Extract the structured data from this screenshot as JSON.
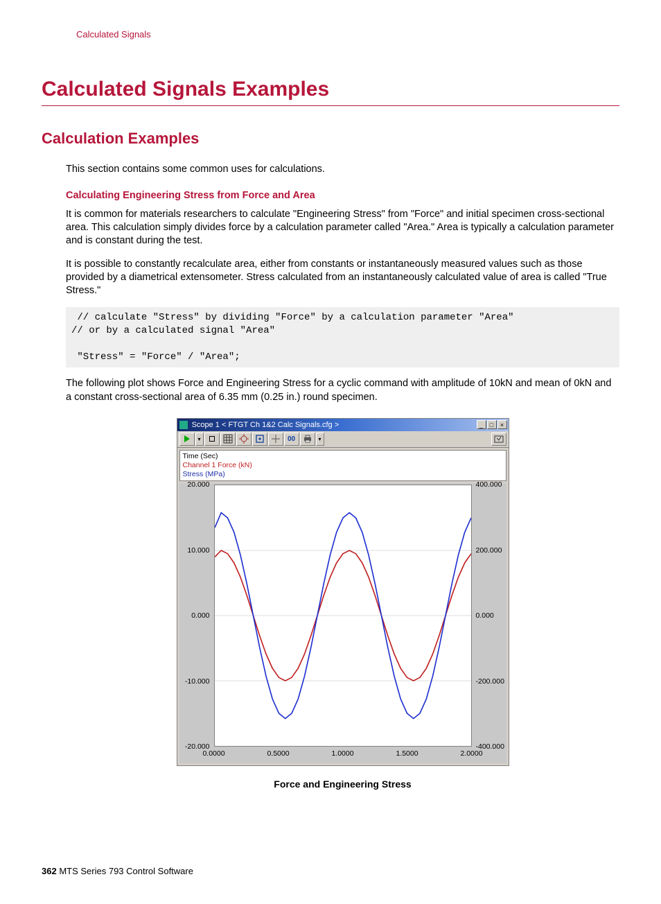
{
  "runhead": "Calculated Signals",
  "h1": "Calculated Signals Examples",
  "h2": "Calculation Examples",
  "intro": "This section contains some common uses for calculations.",
  "h3": "Calculating Engineering Stress from Force and Area",
  "p1": "It is common for materials researchers to calculate \"Engineering Stress\" from \"Force\" and initial specimen cross-sectional area. This calculation simply divides force by a calculation parameter called \"Area.\" Area is typically a calculation parameter and is constant during the test.",
  "p2": "It is possible to constantly recalculate area, either from constants or instantaneously measured values such as those provided by a diametrical extensometer. Stress calculated from an instantaneously calculated value of area is called \"True Stress.\"",
  "code": " // calculate \"Stress\" by dividing \"Force\" by a calculation parameter \"Area\"\n// or by a calculated signal \"Area\"\n\n \"Stress\" = \"Force\" / \"Area\";",
  "p3": "The following plot shows Force and Engineering Stress for a cyclic command with amplitude of 10kN and mean of 0kN and a constant cross-sectional area of 6.35 mm (0.25 in.) round specimen.",
  "scope": {
    "title": "Scope  1 < FTGT Ch 1&2 Calc Signals.cfg >",
    "win_min": "_",
    "win_max": "□",
    "win_close": "×",
    "toolbar": {
      "play": "play-icon",
      "dropdown": "chevron-down-icon",
      "stop": "stop-icon",
      "grid": "grid-icon",
      "zoom_target": "zoom-target-icon",
      "zoom_box": "zoom-box-icon",
      "pan": "pan-icon",
      "reset_label": "00",
      "print": "print-icon",
      "dropdown2": "chevron-down-icon",
      "export": "export-icon"
    },
    "legend": {
      "time": "Time (Sec)",
      "force": "Channel 1 Force (kN)",
      "stress": "Stress (MPa)"
    }
  },
  "caption": "Force and Engineering Stress",
  "footer": {
    "page": "362",
    "title": "MTS Series 793 Control Software"
  },
  "chart_data": {
    "type": "line",
    "title": "Force and Engineering Stress",
    "xlabel": "Time (Sec)",
    "x": [
      0.0,
      0.05,
      0.1,
      0.15,
      0.2,
      0.25,
      0.3,
      0.35,
      0.4,
      0.45,
      0.5,
      0.55,
      0.6,
      0.65,
      0.7,
      0.75,
      0.8,
      0.85,
      0.9,
      0.95,
      1.0,
      1.05,
      1.1,
      1.15,
      1.2,
      1.25,
      1.3,
      1.35,
      1.4,
      1.45,
      1.5,
      1.55,
      1.6,
      1.65,
      1.7,
      1.75,
      1.8,
      1.85,
      1.9,
      1.95,
      2.0
    ],
    "xlim": [
      0.0,
      2.0
    ],
    "xticks": [
      "0.0000",
      "0.5000",
      "1.0000",
      "1.5000",
      "2.0000"
    ],
    "series": [
      {
        "name": "Channel 1 Force (kN)",
        "color": "#c02020",
        "axis": "left",
        "ylabel": "Force (kN)",
        "ylim": [
          -20.0,
          20.0
        ],
        "yticks": [
          "20.000",
          "10.000",
          "0.000",
          "-10.000",
          "-20.000"
        ],
        "values": [
          9.0,
          10.0,
          9.5,
          8.1,
          5.9,
          3.1,
          0.0,
          -3.1,
          -5.9,
          -8.1,
          -9.5,
          -10.0,
          -9.5,
          -8.1,
          -5.9,
          -3.1,
          0.0,
          3.1,
          5.9,
          8.1,
          9.5,
          10.0,
          9.5,
          8.1,
          5.9,
          3.1,
          0.0,
          -3.1,
          -5.9,
          -8.1,
          -9.5,
          -10.0,
          -9.5,
          -8.1,
          -5.9,
          -3.1,
          0.0,
          3.1,
          5.9,
          8.1,
          9.5
        ]
      },
      {
        "name": "Stress (MPa)",
        "color": "#2030d0",
        "axis": "right",
        "ylabel": "Stress (MPa)",
        "ylim": [
          -400.0,
          400.0
        ],
        "yticks": [
          "400.000",
          "200.000",
          "0.000",
          "-200.000",
          "-400.000"
        ],
        "values": [
          270,
          316,
          300,
          256,
          186,
          98,
          0,
          -98,
          -186,
          -256,
          -300,
          -316,
          -300,
          -256,
          -186,
          -98,
          0,
          98,
          186,
          256,
          300,
          316,
          300,
          256,
          186,
          98,
          0,
          -98,
          -186,
          -256,
          -300,
          -316,
          -300,
          -256,
          -186,
          -98,
          0,
          98,
          186,
          256,
          300
        ]
      }
    ]
  }
}
